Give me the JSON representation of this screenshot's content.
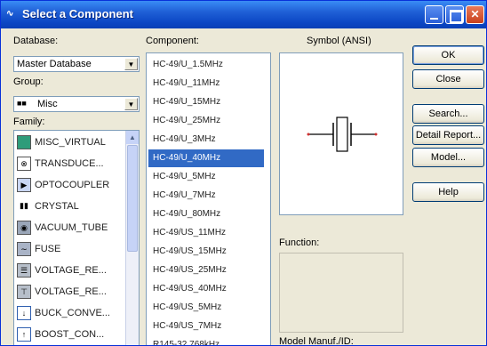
{
  "window": {
    "title": "Select a Component",
    "app_icon": "component-app-icon"
  },
  "database": {
    "label": "Database:",
    "selected": "Master Database"
  },
  "group": {
    "label": "Group:",
    "selected": "Misc"
  },
  "family": {
    "label": "Family:",
    "items": [
      {
        "label": "MISC_VIRTUAL",
        "icon": "misc-virtual-icon"
      },
      {
        "label": "TRANSDUCE...",
        "icon": "transducer-icon"
      },
      {
        "label": "OPTOCOUPLER",
        "icon": "optocoupler-icon"
      },
      {
        "label": "CRYSTAL",
        "icon": "crystal-icon"
      },
      {
        "label": "VACUUM_TUBE",
        "icon": "vacuum-tube-icon"
      },
      {
        "label": "FUSE",
        "icon": "fuse-icon"
      },
      {
        "label": "VOLTAGE_RE...",
        "icon": "voltage-regulator-icon"
      },
      {
        "label": "VOLTAGE_RE...",
        "icon": "voltage-reference-icon"
      },
      {
        "label": "BUCK_CONVE...",
        "icon": "buck-converter-icon"
      },
      {
        "label": "BOOST_CON...",
        "icon": "boost-converter-icon"
      }
    ]
  },
  "component": {
    "label": "Component:",
    "items": [
      "HC-49/U_1.5MHz",
      "HC-49/U_11MHz",
      "HC-49/U_15MHz",
      "HC-49/U_25MHz",
      "HC-49/U_3MHz",
      "HC-49/U_40MHz",
      "HC-49/U_5MHz",
      "HC-49/U_7MHz",
      "HC-49/U_80MHz",
      "HC-49/US_11MHz",
      "HC-49/US_15MHz",
      "HC-49/US_25MHz",
      "HC-49/US_40MHz",
      "HC-49/US_5MHz",
      "HC-49/US_7MHz",
      "R145-32.768kHz"
    ],
    "selected_index": 5
  },
  "symbol": {
    "label": "Symbol (ANSI)"
  },
  "function": {
    "label": "Function:"
  },
  "model_manuf": {
    "label": "Model Manuf./ID:"
  },
  "buttons": {
    "ok": "OK",
    "close": "Close",
    "search": "Search...",
    "detail_report": "Detail Report...",
    "model": "Model...",
    "help": "Help"
  },
  "colors": {
    "selection": "#316ac5",
    "titlebar": "#0b46c4",
    "dialog_bg": "#ece9d8"
  }
}
